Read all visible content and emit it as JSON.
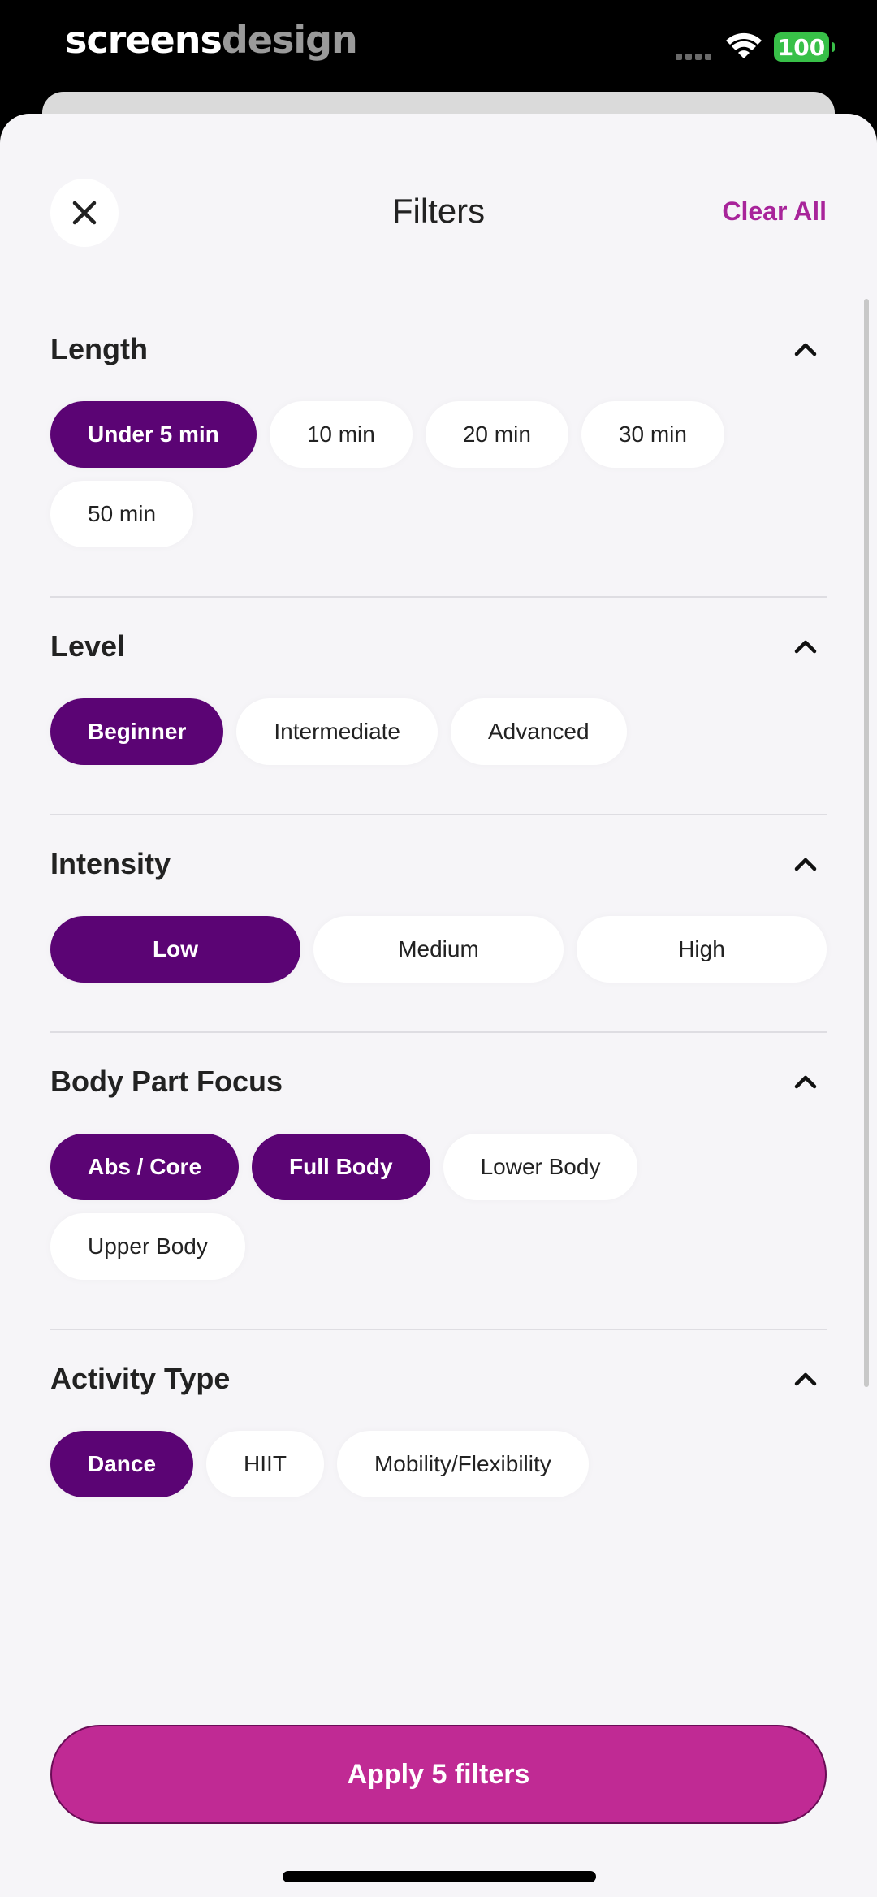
{
  "status": {
    "brand_part1": "screens",
    "brand_part2": "design",
    "battery": "100"
  },
  "header": {
    "title": "Filters",
    "clear_all": "Clear All"
  },
  "sections": [
    {
      "title": "Length",
      "options": [
        {
          "label": "Under 5 min",
          "selected": true
        },
        {
          "label": "10 min",
          "selected": false
        },
        {
          "label": "20 min",
          "selected": false
        },
        {
          "label": "30 min",
          "selected": false
        },
        {
          "label": "50 min",
          "selected": false
        }
      ]
    },
    {
      "title": "Level",
      "options": [
        {
          "label": "Beginner",
          "selected": true
        },
        {
          "label": "Intermediate",
          "selected": false
        },
        {
          "label": "Advanced",
          "selected": false
        }
      ]
    },
    {
      "title": "Intensity",
      "options": [
        {
          "label": "Low",
          "selected": true
        },
        {
          "label": "Medium",
          "selected": false
        },
        {
          "label": "High",
          "selected": false
        }
      ]
    },
    {
      "title": "Body Part Focus",
      "options": [
        {
          "label": "Abs / Core",
          "selected": true
        },
        {
          "label": "Full Body",
          "selected": true
        },
        {
          "label": "Lower Body",
          "selected": false
        },
        {
          "label": "Upper Body",
          "selected": false
        }
      ]
    },
    {
      "title": "Activity Type",
      "options": [
        {
          "label": "Dance",
          "selected": true
        },
        {
          "label": "HIIT",
          "selected": false
        },
        {
          "label": "Mobility/Flexibility",
          "selected": false
        }
      ]
    }
  ],
  "apply_label": "Apply 5 filters",
  "icons": {
    "close": "close-icon",
    "collapse": "chevron-up-icon",
    "wifi": "wifi-icon"
  },
  "colors": {
    "selected_chip": "#5b0474",
    "accent": "#a8249a",
    "apply_button": "#c02a94"
  }
}
